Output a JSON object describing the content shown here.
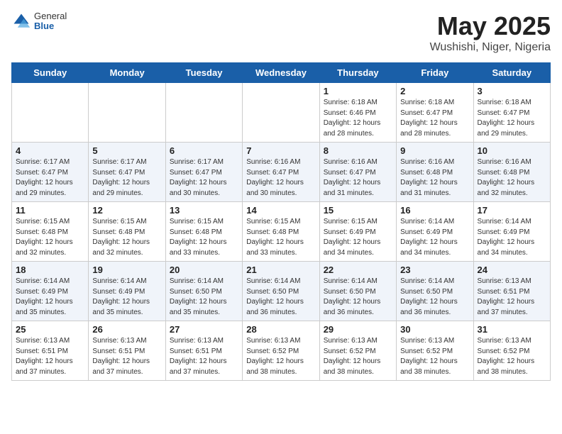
{
  "header": {
    "logo_general": "General",
    "logo_blue": "Blue",
    "title": "May 2025",
    "location": "Wushishi, Niger, Nigeria"
  },
  "days_of_week": [
    "Sunday",
    "Monday",
    "Tuesday",
    "Wednesday",
    "Thursday",
    "Friday",
    "Saturday"
  ],
  "weeks": [
    [
      {
        "day": "",
        "info": ""
      },
      {
        "day": "",
        "info": ""
      },
      {
        "day": "",
        "info": ""
      },
      {
        "day": "",
        "info": ""
      },
      {
        "day": "1",
        "info": "Sunrise: 6:18 AM\nSunset: 6:46 PM\nDaylight: 12 hours\nand 28 minutes."
      },
      {
        "day": "2",
        "info": "Sunrise: 6:18 AM\nSunset: 6:47 PM\nDaylight: 12 hours\nand 28 minutes."
      },
      {
        "day": "3",
        "info": "Sunrise: 6:18 AM\nSunset: 6:47 PM\nDaylight: 12 hours\nand 29 minutes."
      }
    ],
    [
      {
        "day": "4",
        "info": "Sunrise: 6:17 AM\nSunset: 6:47 PM\nDaylight: 12 hours\nand 29 minutes."
      },
      {
        "day": "5",
        "info": "Sunrise: 6:17 AM\nSunset: 6:47 PM\nDaylight: 12 hours\nand 29 minutes."
      },
      {
        "day": "6",
        "info": "Sunrise: 6:17 AM\nSunset: 6:47 PM\nDaylight: 12 hours\nand 30 minutes."
      },
      {
        "day": "7",
        "info": "Sunrise: 6:16 AM\nSunset: 6:47 PM\nDaylight: 12 hours\nand 30 minutes."
      },
      {
        "day": "8",
        "info": "Sunrise: 6:16 AM\nSunset: 6:47 PM\nDaylight: 12 hours\nand 31 minutes."
      },
      {
        "day": "9",
        "info": "Sunrise: 6:16 AM\nSunset: 6:48 PM\nDaylight: 12 hours\nand 31 minutes."
      },
      {
        "day": "10",
        "info": "Sunrise: 6:16 AM\nSunset: 6:48 PM\nDaylight: 12 hours\nand 32 minutes."
      }
    ],
    [
      {
        "day": "11",
        "info": "Sunrise: 6:15 AM\nSunset: 6:48 PM\nDaylight: 12 hours\nand 32 minutes."
      },
      {
        "day": "12",
        "info": "Sunrise: 6:15 AM\nSunset: 6:48 PM\nDaylight: 12 hours\nand 32 minutes."
      },
      {
        "day": "13",
        "info": "Sunrise: 6:15 AM\nSunset: 6:48 PM\nDaylight: 12 hours\nand 33 minutes."
      },
      {
        "day": "14",
        "info": "Sunrise: 6:15 AM\nSunset: 6:48 PM\nDaylight: 12 hours\nand 33 minutes."
      },
      {
        "day": "15",
        "info": "Sunrise: 6:15 AM\nSunset: 6:49 PM\nDaylight: 12 hours\nand 34 minutes."
      },
      {
        "day": "16",
        "info": "Sunrise: 6:14 AM\nSunset: 6:49 PM\nDaylight: 12 hours\nand 34 minutes."
      },
      {
        "day": "17",
        "info": "Sunrise: 6:14 AM\nSunset: 6:49 PM\nDaylight: 12 hours\nand 34 minutes."
      }
    ],
    [
      {
        "day": "18",
        "info": "Sunrise: 6:14 AM\nSunset: 6:49 PM\nDaylight: 12 hours\nand 35 minutes."
      },
      {
        "day": "19",
        "info": "Sunrise: 6:14 AM\nSunset: 6:49 PM\nDaylight: 12 hours\nand 35 minutes."
      },
      {
        "day": "20",
        "info": "Sunrise: 6:14 AM\nSunset: 6:50 PM\nDaylight: 12 hours\nand 35 minutes."
      },
      {
        "day": "21",
        "info": "Sunrise: 6:14 AM\nSunset: 6:50 PM\nDaylight: 12 hours\nand 36 minutes."
      },
      {
        "day": "22",
        "info": "Sunrise: 6:14 AM\nSunset: 6:50 PM\nDaylight: 12 hours\nand 36 minutes."
      },
      {
        "day": "23",
        "info": "Sunrise: 6:14 AM\nSunset: 6:50 PM\nDaylight: 12 hours\nand 36 minutes."
      },
      {
        "day": "24",
        "info": "Sunrise: 6:13 AM\nSunset: 6:51 PM\nDaylight: 12 hours\nand 37 minutes."
      }
    ],
    [
      {
        "day": "25",
        "info": "Sunrise: 6:13 AM\nSunset: 6:51 PM\nDaylight: 12 hours\nand 37 minutes."
      },
      {
        "day": "26",
        "info": "Sunrise: 6:13 AM\nSunset: 6:51 PM\nDaylight: 12 hours\nand 37 minutes."
      },
      {
        "day": "27",
        "info": "Sunrise: 6:13 AM\nSunset: 6:51 PM\nDaylight: 12 hours\nand 37 minutes."
      },
      {
        "day": "28",
        "info": "Sunrise: 6:13 AM\nSunset: 6:52 PM\nDaylight: 12 hours\nand 38 minutes."
      },
      {
        "day": "29",
        "info": "Sunrise: 6:13 AM\nSunset: 6:52 PM\nDaylight: 12 hours\nand 38 minutes."
      },
      {
        "day": "30",
        "info": "Sunrise: 6:13 AM\nSunset: 6:52 PM\nDaylight: 12 hours\nand 38 minutes."
      },
      {
        "day": "31",
        "info": "Sunrise: 6:13 AM\nSunset: 6:52 PM\nDaylight: 12 hours\nand 38 minutes."
      }
    ]
  ]
}
